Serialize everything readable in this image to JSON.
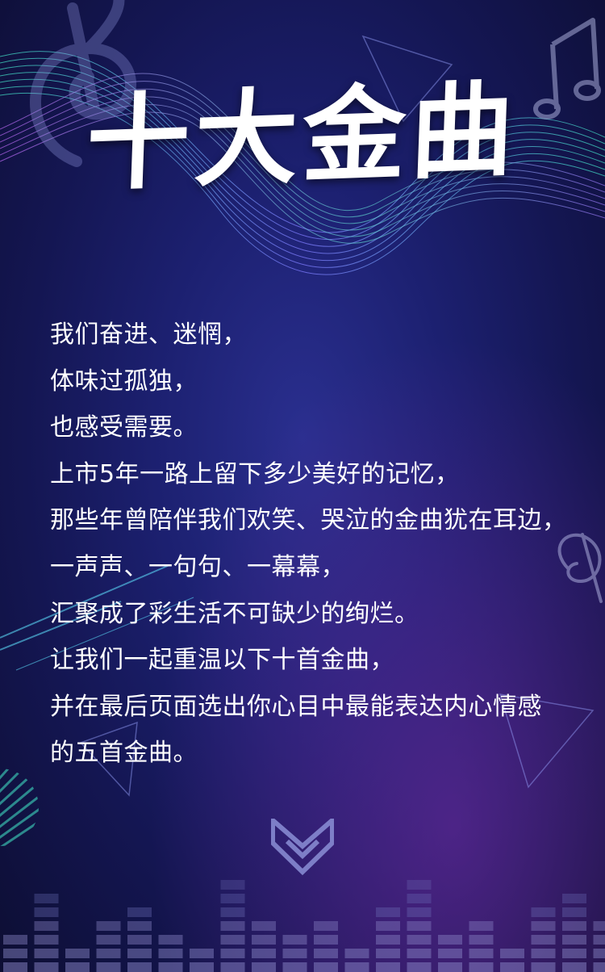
{
  "title": "十大金曲",
  "poem": {
    "lines": [
      "我们奋进、迷惘，",
      "体味过孤独，",
      "也感受需要。",
      "上市5年一路上留下多少美好的记忆，",
      "那些年曾陪伴我们欢笑、哭泣的金曲犹在耳边，",
      "一声声、一句句、一幕幕，",
      "汇聚成了彩生活不可缺少的绚烂。",
      "让我们一起重温以下十首金曲，",
      "并在最后页面选出你心目中最能表达内心情感",
      "的五首金曲。"
    ]
  },
  "colors": {
    "background_center": "#2a2f8f",
    "background_edge": "#0d0e33",
    "wave_teal": "#3fd9c0",
    "wave_purple": "#9b6bff",
    "text": "#ffffff"
  },
  "icons": [
    "treble-clef-icon",
    "music-note-icon",
    "down-chevron-icon"
  ]
}
